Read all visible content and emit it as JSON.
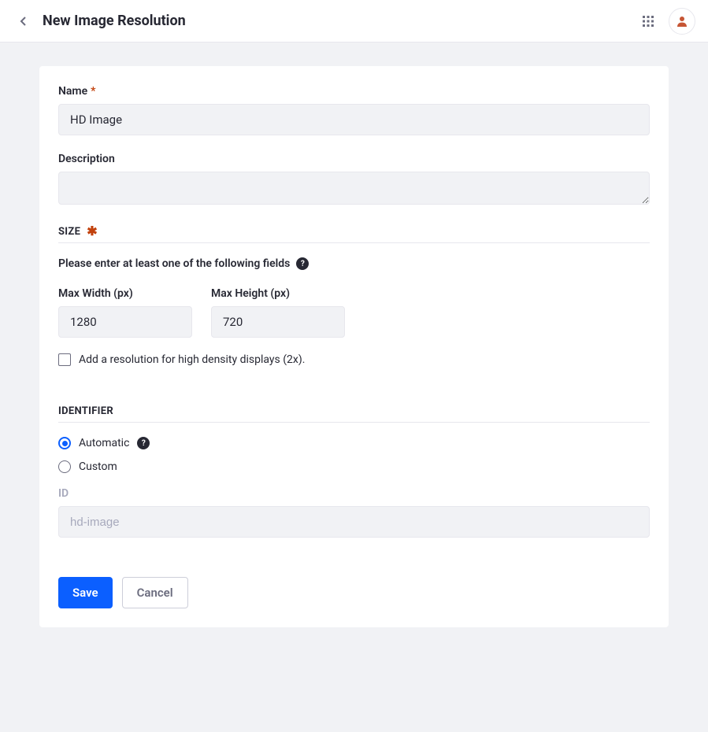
{
  "header": {
    "title": "New Image Resolution"
  },
  "form": {
    "name_label": "Name",
    "name_value": "HD Image",
    "description_label": "Description",
    "description_value": ""
  },
  "size": {
    "section_title": "SIZE",
    "help_text": "Please enter at least one of the following fields",
    "max_width_label": "Max Width (px)",
    "max_width_value": "1280",
    "max_height_label": "Max Height (px)",
    "max_height_value": "720",
    "high_density_label": "Add a resolution for high density displays (2x)."
  },
  "identifier": {
    "section_title": "IDENTIFIER",
    "automatic_label": "Automatic",
    "custom_label": "Custom",
    "id_label": "ID",
    "id_value": "hd-image"
  },
  "actions": {
    "save_label": "Save",
    "cancel_label": "Cancel"
  }
}
